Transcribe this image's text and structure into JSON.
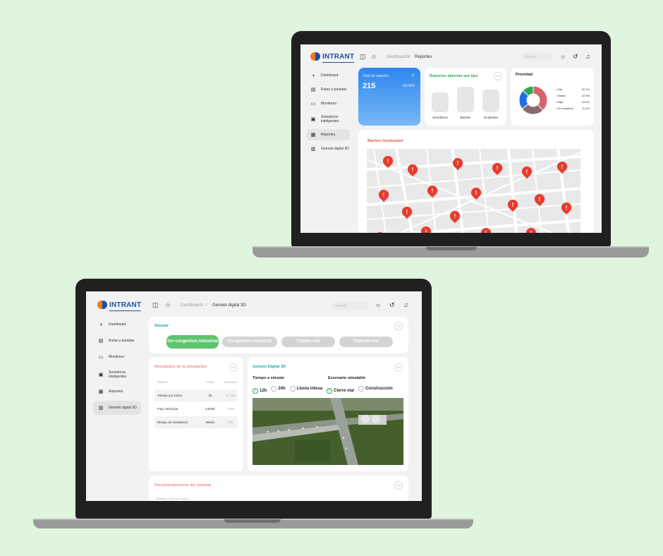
{
  "brand": {
    "name": "INTRANT"
  },
  "sidebar": {
    "items": [
      {
        "label": "Dashboard",
        "icon": "pie-chart-icon"
      },
      {
        "label": "Rutas y paradas",
        "icon": "route-icon"
      },
      {
        "label": "Monitoreo",
        "icon": "folder-icon"
      },
      {
        "label": "Semaforos inteligentes",
        "icon": "traffic-light-icon"
      },
      {
        "label": "Reportes",
        "icon": "report-icon"
      },
      {
        "label": "Gemelo digital 3D",
        "icon": "cube-icon"
      }
    ]
  },
  "top": {
    "breadcrumb_root": "Dashboards",
    "breadcrumb_current": "Reportes",
    "search_placeholder": "Search",
    "cards": {
      "total": {
        "title": "Total de reportes",
        "value": "215",
        "change": "-18.03%"
      },
      "types": {
        "title": "Reportes abiertos por tipo",
        "bars": [
          {
            "label": "Semáforos",
            "value": 0.55
          },
          {
            "label": "Baches",
            "value": 1.0
          },
          {
            "label": "Incidentes",
            "value": 0.75
          }
        ]
      },
      "priority": {
        "title": "Prioridad",
        "legend": [
          {
            "label": "Alta",
            "value": "32.1%",
            "color": "#d9626f"
          },
          {
            "label": "Media",
            "value": "22.9%",
            "color": "#8a6a6a"
          },
          {
            "label": "Baja",
            "value": "18.9%",
            "color": "#1e6fe0"
          },
          {
            "label": "Sin clasificar",
            "value": "11.2%",
            "color": "#2ea94e"
          }
        ]
      },
      "map": {
        "title": "Baches localizados"
      }
    }
  },
  "bottom": {
    "breadcrumb_root": "Dashboards",
    "breadcrumb_current": "Gemelo digital 3D",
    "search_placeholder": "Search",
    "simulate": {
      "title": "Simular",
      "options": [
        "Sin congestion industrial",
        "Congestión industrial",
        "Fluidez vial",
        "Embudo vial"
      ]
    },
    "results": {
      "title": "Resultados de la simulación",
      "headers": [
        "Metrica",
        "Antes",
        "Despues"
      ],
      "rows": [
        [
          "Tiempo por tramo",
          "33",
          "27 min"
        ],
        [
          "Flujo Vehicular",
          "3,500h",
          "-40%"
        ],
        [
          "Riesgo de inundacion",
          "Medio",
          "Alto"
        ]
      ]
    },
    "twin": {
      "title": "Gemelo Digital 3D",
      "time_label": "Tiempo a simular",
      "scenario_label": "Escenario simulable",
      "times": [
        "12h",
        "24h"
      ],
      "scenarios": [
        "Lluvia intesa",
        "Cierre vial",
        "Construcción"
      ]
    },
    "recommendations": {
      "title": "Recomendaciones del sistema",
      "text": "Redirigir el flujo por carril 3"
    }
  }
}
